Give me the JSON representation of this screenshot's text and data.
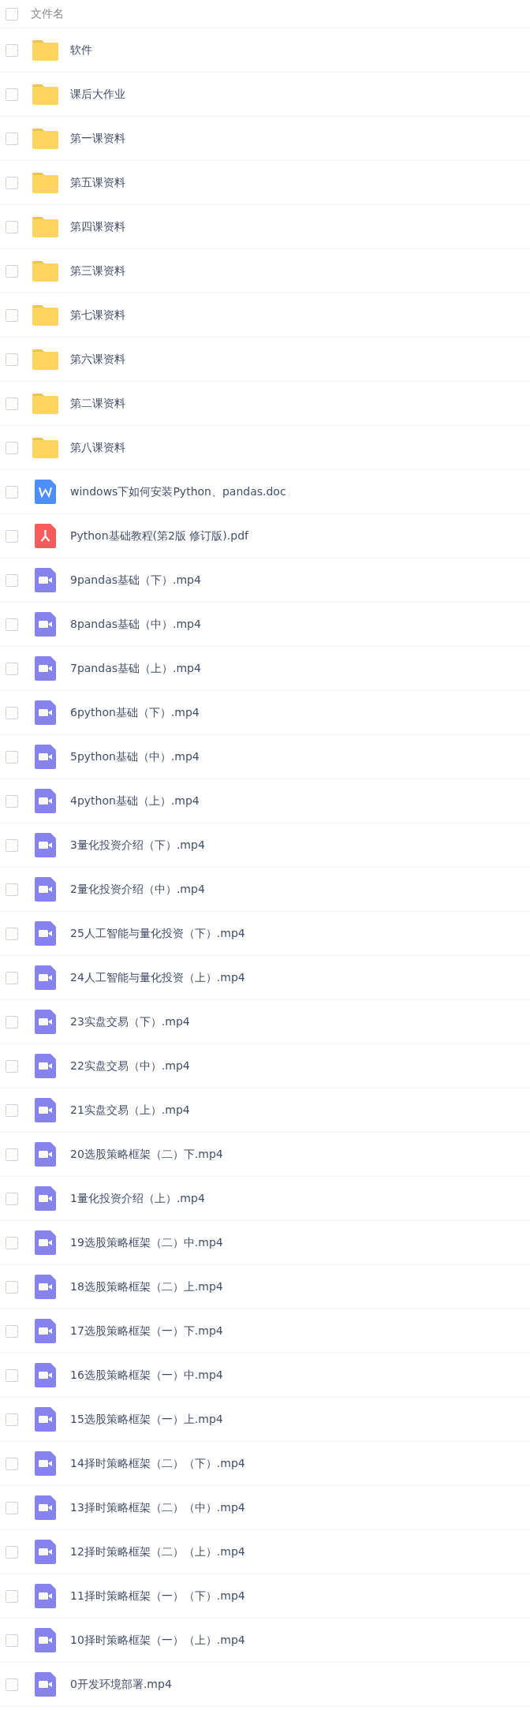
{
  "header": {
    "label": "文件名",
    "checked": false
  },
  "files": [
    {
      "name": "软件",
      "kind": "folder",
      "checked": false
    },
    {
      "name": "课后大作业",
      "kind": "folder",
      "checked": false
    },
    {
      "name": "第一课资料",
      "kind": "folder",
      "checked": false
    },
    {
      "name": "第五课资料",
      "kind": "folder",
      "checked": false
    },
    {
      "name": "第四课资料",
      "kind": "folder",
      "checked": false
    },
    {
      "name": "第三课资料",
      "kind": "folder",
      "checked": false
    },
    {
      "name": "第七课资料",
      "kind": "folder",
      "checked": false
    },
    {
      "name": "第六课资料",
      "kind": "folder",
      "checked": false
    },
    {
      "name": "第二课资料",
      "kind": "folder",
      "checked": false
    },
    {
      "name": "第八课资料",
      "kind": "folder",
      "checked": false
    },
    {
      "name": "windows下如何安装Python、pandas.doc",
      "kind": "doc",
      "checked": false
    },
    {
      "name": "Python基础教程(第2版 修订版).pdf",
      "kind": "pdf",
      "checked": false
    },
    {
      "name": "9pandas基础（下）.mp4",
      "kind": "video",
      "checked": false
    },
    {
      "name": "8pandas基础（中）.mp4",
      "kind": "video",
      "checked": false
    },
    {
      "name": "7pandas基础（上）.mp4",
      "kind": "video",
      "checked": false
    },
    {
      "name": "6python基础（下）.mp4",
      "kind": "video",
      "checked": false
    },
    {
      "name": "5python基础（中）.mp4",
      "kind": "video",
      "checked": false
    },
    {
      "name": "4python基础（上）.mp4",
      "kind": "video",
      "checked": false
    },
    {
      "name": "3量化投资介绍（下）.mp4",
      "kind": "video",
      "checked": false
    },
    {
      "name": "2量化投资介绍（中）.mp4",
      "kind": "video",
      "checked": false
    },
    {
      "name": "25人工智能与量化投资（下）.mp4",
      "kind": "video",
      "checked": false
    },
    {
      "name": "24人工智能与量化投资（上）.mp4",
      "kind": "video",
      "checked": false
    },
    {
      "name": "23实盘交易（下）.mp4",
      "kind": "video",
      "checked": false
    },
    {
      "name": "22实盘交易（中）.mp4",
      "kind": "video",
      "checked": false
    },
    {
      "name": "21实盘交易（上）.mp4",
      "kind": "video",
      "checked": false
    },
    {
      "name": "20选股策略框架（二）下.mp4",
      "kind": "video",
      "checked": false
    },
    {
      "name": "1量化投资介绍（上）.mp4",
      "kind": "video",
      "checked": false
    },
    {
      "name": "19选股策略框架（二）中.mp4",
      "kind": "video",
      "checked": false
    },
    {
      "name": "18选股策略框架（二）上.mp4",
      "kind": "video",
      "checked": false
    },
    {
      "name": "17选股策略框架（一）下.mp4",
      "kind": "video",
      "checked": false
    },
    {
      "name": "16选股策略框架（一）中.mp4",
      "kind": "video",
      "checked": false
    },
    {
      "name": "15选股策略框架（一）上.mp4",
      "kind": "video",
      "checked": false
    },
    {
      "name": "14择时策略框架（二）（下）.mp4",
      "kind": "video",
      "checked": false
    },
    {
      "name": "13择时策略框架（二）（中）.mp4",
      "kind": "video",
      "checked": false
    },
    {
      "name": "12择时策略框架（二）（上）.mp4",
      "kind": "video",
      "checked": false
    },
    {
      "name": "11择时策略框架（一）（下）.mp4",
      "kind": "video",
      "checked": false
    },
    {
      "name": "10择时策略框架（一）（上）.mp4",
      "kind": "video",
      "checked": false
    },
    {
      "name": "0开发环境部署.mp4",
      "kind": "video",
      "checked": false
    }
  ]
}
